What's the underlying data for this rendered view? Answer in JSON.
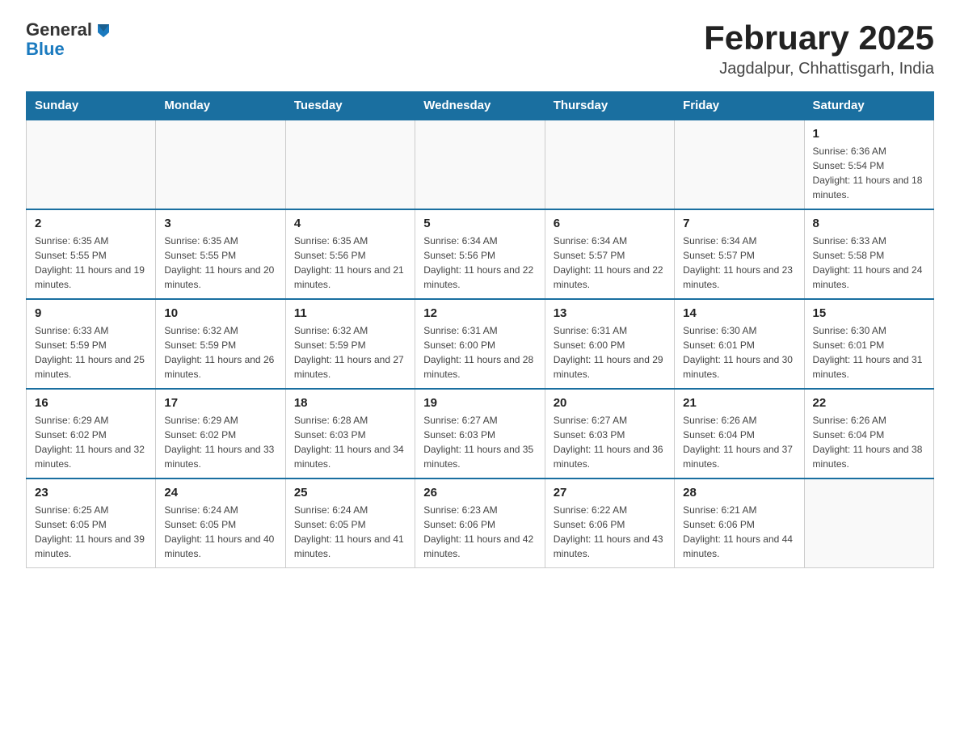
{
  "header": {
    "title": "February 2025",
    "subtitle": "Jagdalpur, Chhattisgarh, India"
  },
  "logo": {
    "general": "General",
    "blue": "Blue"
  },
  "weekdays": [
    "Sunday",
    "Monday",
    "Tuesday",
    "Wednesday",
    "Thursday",
    "Friday",
    "Saturday"
  ],
  "weeks": [
    [
      {
        "day": "",
        "info": ""
      },
      {
        "day": "",
        "info": ""
      },
      {
        "day": "",
        "info": ""
      },
      {
        "day": "",
        "info": ""
      },
      {
        "day": "",
        "info": ""
      },
      {
        "day": "",
        "info": ""
      },
      {
        "day": "1",
        "info": "Sunrise: 6:36 AM\nSunset: 5:54 PM\nDaylight: 11 hours and 18 minutes."
      }
    ],
    [
      {
        "day": "2",
        "info": "Sunrise: 6:35 AM\nSunset: 5:55 PM\nDaylight: 11 hours and 19 minutes."
      },
      {
        "day": "3",
        "info": "Sunrise: 6:35 AM\nSunset: 5:55 PM\nDaylight: 11 hours and 20 minutes."
      },
      {
        "day": "4",
        "info": "Sunrise: 6:35 AM\nSunset: 5:56 PM\nDaylight: 11 hours and 21 minutes."
      },
      {
        "day": "5",
        "info": "Sunrise: 6:34 AM\nSunset: 5:56 PM\nDaylight: 11 hours and 22 minutes."
      },
      {
        "day": "6",
        "info": "Sunrise: 6:34 AM\nSunset: 5:57 PM\nDaylight: 11 hours and 22 minutes."
      },
      {
        "day": "7",
        "info": "Sunrise: 6:34 AM\nSunset: 5:57 PM\nDaylight: 11 hours and 23 minutes."
      },
      {
        "day": "8",
        "info": "Sunrise: 6:33 AM\nSunset: 5:58 PM\nDaylight: 11 hours and 24 minutes."
      }
    ],
    [
      {
        "day": "9",
        "info": "Sunrise: 6:33 AM\nSunset: 5:59 PM\nDaylight: 11 hours and 25 minutes."
      },
      {
        "day": "10",
        "info": "Sunrise: 6:32 AM\nSunset: 5:59 PM\nDaylight: 11 hours and 26 minutes."
      },
      {
        "day": "11",
        "info": "Sunrise: 6:32 AM\nSunset: 5:59 PM\nDaylight: 11 hours and 27 minutes."
      },
      {
        "day": "12",
        "info": "Sunrise: 6:31 AM\nSunset: 6:00 PM\nDaylight: 11 hours and 28 minutes."
      },
      {
        "day": "13",
        "info": "Sunrise: 6:31 AM\nSunset: 6:00 PM\nDaylight: 11 hours and 29 minutes."
      },
      {
        "day": "14",
        "info": "Sunrise: 6:30 AM\nSunset: 6:01 PM\nDaylight: 11 hours and 30 minutes."
      },
      {
        "day": "15",
        "info": "Sunrise: 6:30 AM\nSunset: 6:01 PM\nDaylight: 11 hours and 31 minutes."
      }
    ],
    [
      {
        "day": "16",
        "info": "Sunrise: 6:29 AM\nSunset: 6:02 PM\nDaylight: 11 hours and 32 minutes."
      },
      {
        "day": "17",
        "info": "Sunrise: 6:29 AM\nSunset: 6:02 PM\nDaylight: 11 hours and 33 minutes."
      },
      {
        "day": "18",
        "info": "Sunrise: 6:28 AM\nSunset: 6:03 PM\nDaylight: 11 hours and 34 minutes."
      },
      {
        "day": "19",
        "info": "Sunrise: 6:27 AM\nSunset: 6:03 PM\nDaylight: 11 hours and 35 minutes."
      },
      {
        "day": "20",
        "info": "Sunrise: 6:27 AM\nSunset: 6:03 PM\nDaylight: 11 hours and 36 minutes."
      },
      {
        "day": "21",
        "info": "Sunrise: 6:26 AM\nSunset: 6:04 PM\nDaylight: 11 hours and 37 minutes."
      },
      {
        "day": "22",
        "info": "Sunrise: 6:26 AM\nSunset: 6:04 PM\nDaylight: 11 hours and 38 minutes."
      }
    ],
    [
      {
        "day": "23",
        "info": "Sunrise: 6:25 AM\nSunset: 6:05 PM\nDaylight: 11 hours and 39 minutes."
      },
      {
        "day": "24",
        "info": "Sunrise: 6:24 AM\nSunset: 6:05 PM\nDaylight: 11 hours and 40 minutes."
      },
      {
        "day": "25",
        "info": "Sunrise: 6:24 AM\nSunset: 6:05 PM\nDaylight: 11 hours and 41 minutes."
      },
      {
        "day": "26",
        "info": "Sunrise: 6:23 AM\nSunset: 6:06 PM\nDaylight: 11 hours and 42 minutes."
      },
      {
        "day": "27",
        "info": "Sunrise: 6:22 AM\nSunset: 6:06 PM\nDaylight: 11 hours and 43 minutes."
      },
      {
        "day": "28",
        "info": "Sunrise: 6:21 AM\nSunset: 6:06 PM\nDaylight: 11 hours and 44 minutes."
      },
      {
        "day": "",
        "info": ""
      }
    ]
  ]
}
